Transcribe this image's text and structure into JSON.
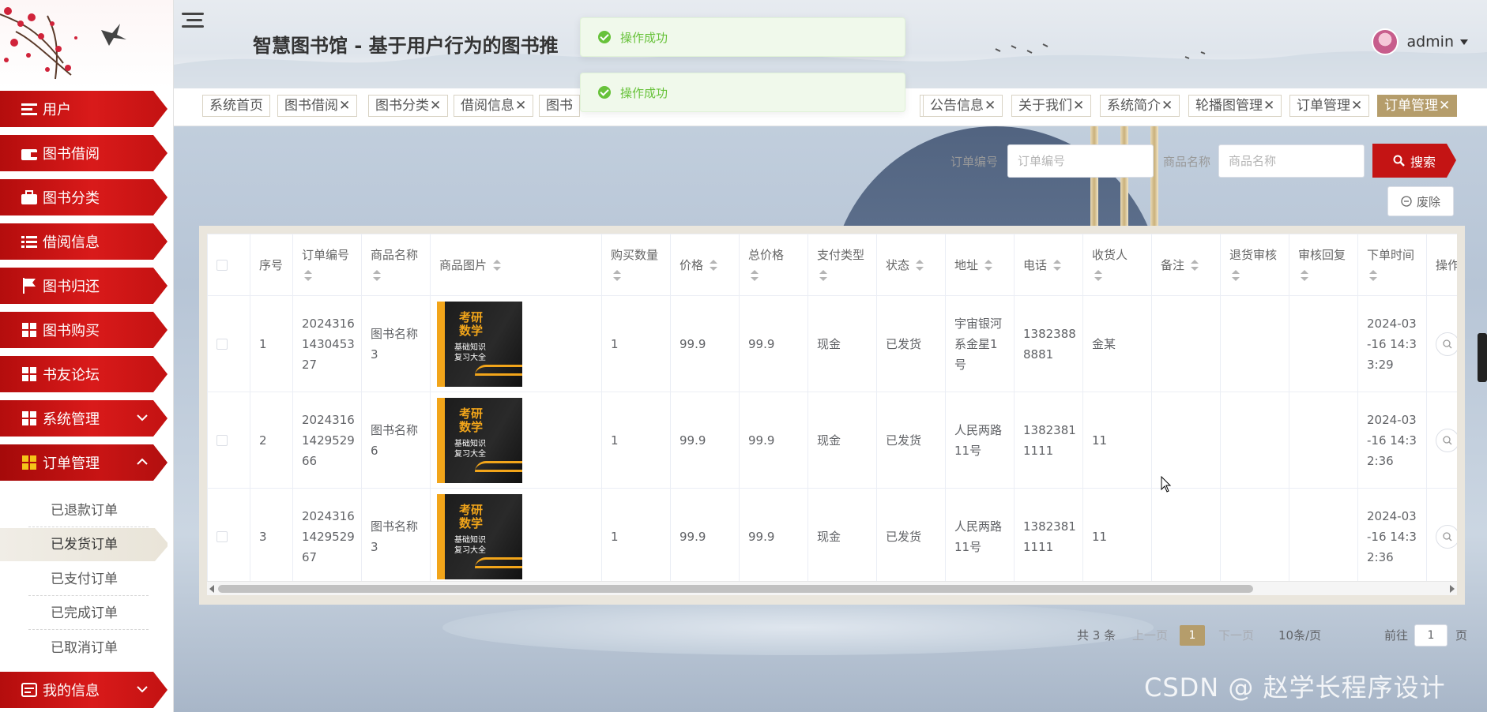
{
  "header": {
    "title": "智慧图书馆 - 基于用户行为的图书推",
    "user": "admin"
  },
  "toasts": [
    "操作成功",
    "操作成功"
  ],
  "sidebar": {
    "items": [
      {
        "label": "用户",
        "icon": "list-icon"
      },
      {
        "label": "图书借阅",
        "icon": "wallet-icon"
      },
      {
        "label": "图书分类",
        "icon": "briefcase-icon"
      },
      {
        "label": "借阅信息",
        "icon": "list-check-icon"
      },
      {
        "label": "图书归还",
        "icon": "flag-icon"
      },
      {
        "label": "图书购买",
        "icon": "grid-icon"
      },
      {
        "label": "书友论坛",
        "icon": "grid-icon"
      },
      {
        "label": "系统管理",
        "icon": "grid-icon"
      },
      {
        "label": "订单管理",
        "icon": "grid-icon"
      }
    ],
    "submenu": [
      "已退款订单",
      "已发货订单",
      "已支付订单",
      "已完成订单",
      "已取消订单"
    ],
    "active_sub": "已发货订单",
    "last_item": {
      "label": "我的信息",
      "icon": "id-card-icon"
    }
  },
  "tabs": [
    {
      "label": "系统首页",
      "closable": false
    },
    {
      "label": "图书借阅",
      "closable": true
    },
    {
      "label": "图书分类",
      "closable": true
    },
    {
      "label": "借阅信息",
      "closable": true
    },
    {
      "label": "图书",
      "closable": false
    },
    {
      "label": "公告信息",
      "closable": true
    },
    {
      "label": "关于我们",
      "closable": true
    },
    {
      "label": "系统简介",
      "closable": true
    },
    {
      "label": "轮播图管理",
      "closable": true
    },
    {
      "label": "订单管理",
      "closable": true
    },
    {
      "label": "订单管理",
      "closable": true
    }
  ],
  "search": {
    "order_label": "订单编号",
    "order_placeholder": "订单编号",
    "product_label": "商品名称",
    "product_placeholder": "商品名称",
    "search_button": "搜索",
    "delete_button": "废除"
  },
  "table": {
    "columns": [
      "序号",
      "订单编号",
      "商品名称",
      "商品图片",
      "购买数量",
      "价格",
      "总价格",
      "支付类型",
      "状态",
      "地址",
      "电话",
      "收货人",
      "备注",
      "退货审核",
      "审核回复",
      "下单时间",
      "操作"
    ],
    "cover_text": {
      "title": "考研\n数学",
      "subtitle": "基础知识\n复习大全"
    },
    "rows": [
      {
        "index": "1",
        "order_no": "2024316\n1430453\n27",
        "product": "图书名称\n3",
        "qty": "1",
        "price": "99.9",
        "total": "99.9",
        "pay": "现金",
        "status": "已发货",
        "address": "宇宙银河\n系金星1\n号",
        "phone": "1382388\n8881",
        "receiver": "金某",
        "remark": "",
        "return_review": "",
        "review_reply": "",
        "time": "2024-03\n-16 14:3\n3:29"
      },
      {
        "index": "2",
        "order_no": "2024316\n1429529\n66",
        "product": "图书名称\n6",
        "qty": "1",
        "price": "99.9",
        "total": "99.9",
        "pay": "现金",
        "status": "已发货",
        "address": "人民两路\n11号",
        "phone": "1382381\n1111",
        "receiver": "11",
        "remark": "",
        "return_review": "",
        "review_reply": "",
        "time": "2024-03\n-16 14:3\n2:36"
      },
      {
        "index": "3",
        "order_no": "2024316\n1429529\n67",
        "product": "图书名称\n3",
        "qty": "1",
        "price": "99.9",
        "total": "99.9",
        "pay": "现金",
        "status": "已发货",
        "address": "人民两路\n11号",
        "phone": "1382381\n1111",
        "receiver": "11",
        "remark": "",
        "return_review": "",
        "review_reply": "",
        "time": "2024-03\n-16 14:3\n2:36"
      }
    ]
  },
  "pagination": {
    "total": "共 3 条",
    "prev": "上一页",
    "current": "1",
    "next": "下一页",
    "page_size": "10条/页",
    "goto": "前往",
    "goto_value": "1",
    "page_unit": "页"
  },
  "watermark": "CSDN @ 赵学长程序设计",
  "colors": {
    "primary_red": "#c41414",
    "accent_gold": "#b59d6b",
    "success_green": "#67c23a"
  }
}
